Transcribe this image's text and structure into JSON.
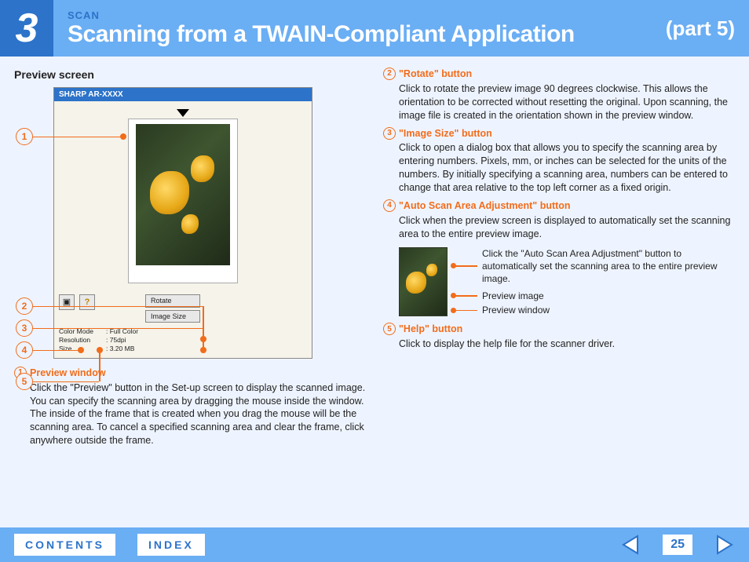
{
  "header": {
    "chapter_number": "3",
    "section_small": "SCAN",
    "title": "Scanning from a TWAIN-Compliant Application",
    "part_label": "(part 5)"
  },
  "left": {
    "section_label": "Preview screen",
    "window_title": "SHARP AR-XXXX",
    "btn_rotate": "Rotate",
    "btn_image_size": "Image Size",
    "info_color_label": "Color Mode",
    "info_color_val": ": Full Color",
    "info_res_label": "Resolution",
    "info_res_val": ": 75dpi",
    "info_size_label": "Size",
    "info_size_val": ": 3.20 MB",
    "callouts": {
      "c1": "1",
      "c2": "2",
      "c3": "3",
      "c4": "4",
      "c5": "5"
    },
    "item1_num": "1",
    "item1_title": "Preview window",
    "item1_body": "Click the \"Preview\" button in the Set-up screen to display the scanned image. You can specify the scanning area by dragging the mouse inside the window. The inside of the frame that is created when you drag the mouse will be the scanning area. To cancel a specified scanning area and clear the frame, click anywhere outside the frame."
  },
  "right": {
    "item2_num": "2",
    "item2_title": "\"Rotate\" button",
    "item2_body": "Click to rotate the preview image 90 degrees clockwise. This allows the orientation to be corrected without resetting the original. Upon scanning, the image file is created in the orientation shown in the preview window.",
    "item3_num": "3",
    "item3_title": "\"Image Size\" button",
    "item3_body": "Click to open a dialog box that allows you to specify the scanning area by entering numbers. Pixels, mm, or inches can be selected for the units of the numbers. By initially specifying a scanning area, numbers can be entered to change that area relative to the top left corner as a fixed origin.",
    "item4_num": "4",
    "item4_title": "\"Auto Scan Area Adjustment\" button",
    "item4_body": "Click when the preview screen is displayed to automatically set the scanning area to the entire preview image.",
    "mini_label1": "Click the \"Auto Scan Area Adjustment\" button to automatically set the scanning area to the entire preview image.",
    "mini_label2": "Preview image",
    "mini_label3": "Preview window",
    "item5_num": "5",
    "item5_title": "\"Help\" button",
    "item5_body": "Click to display the help file for the scanner driver."
  },
  "footer": {
    "contents": "CONTENTS",
    "index": "INDEX",
    "page_number": "25"
  }
}
